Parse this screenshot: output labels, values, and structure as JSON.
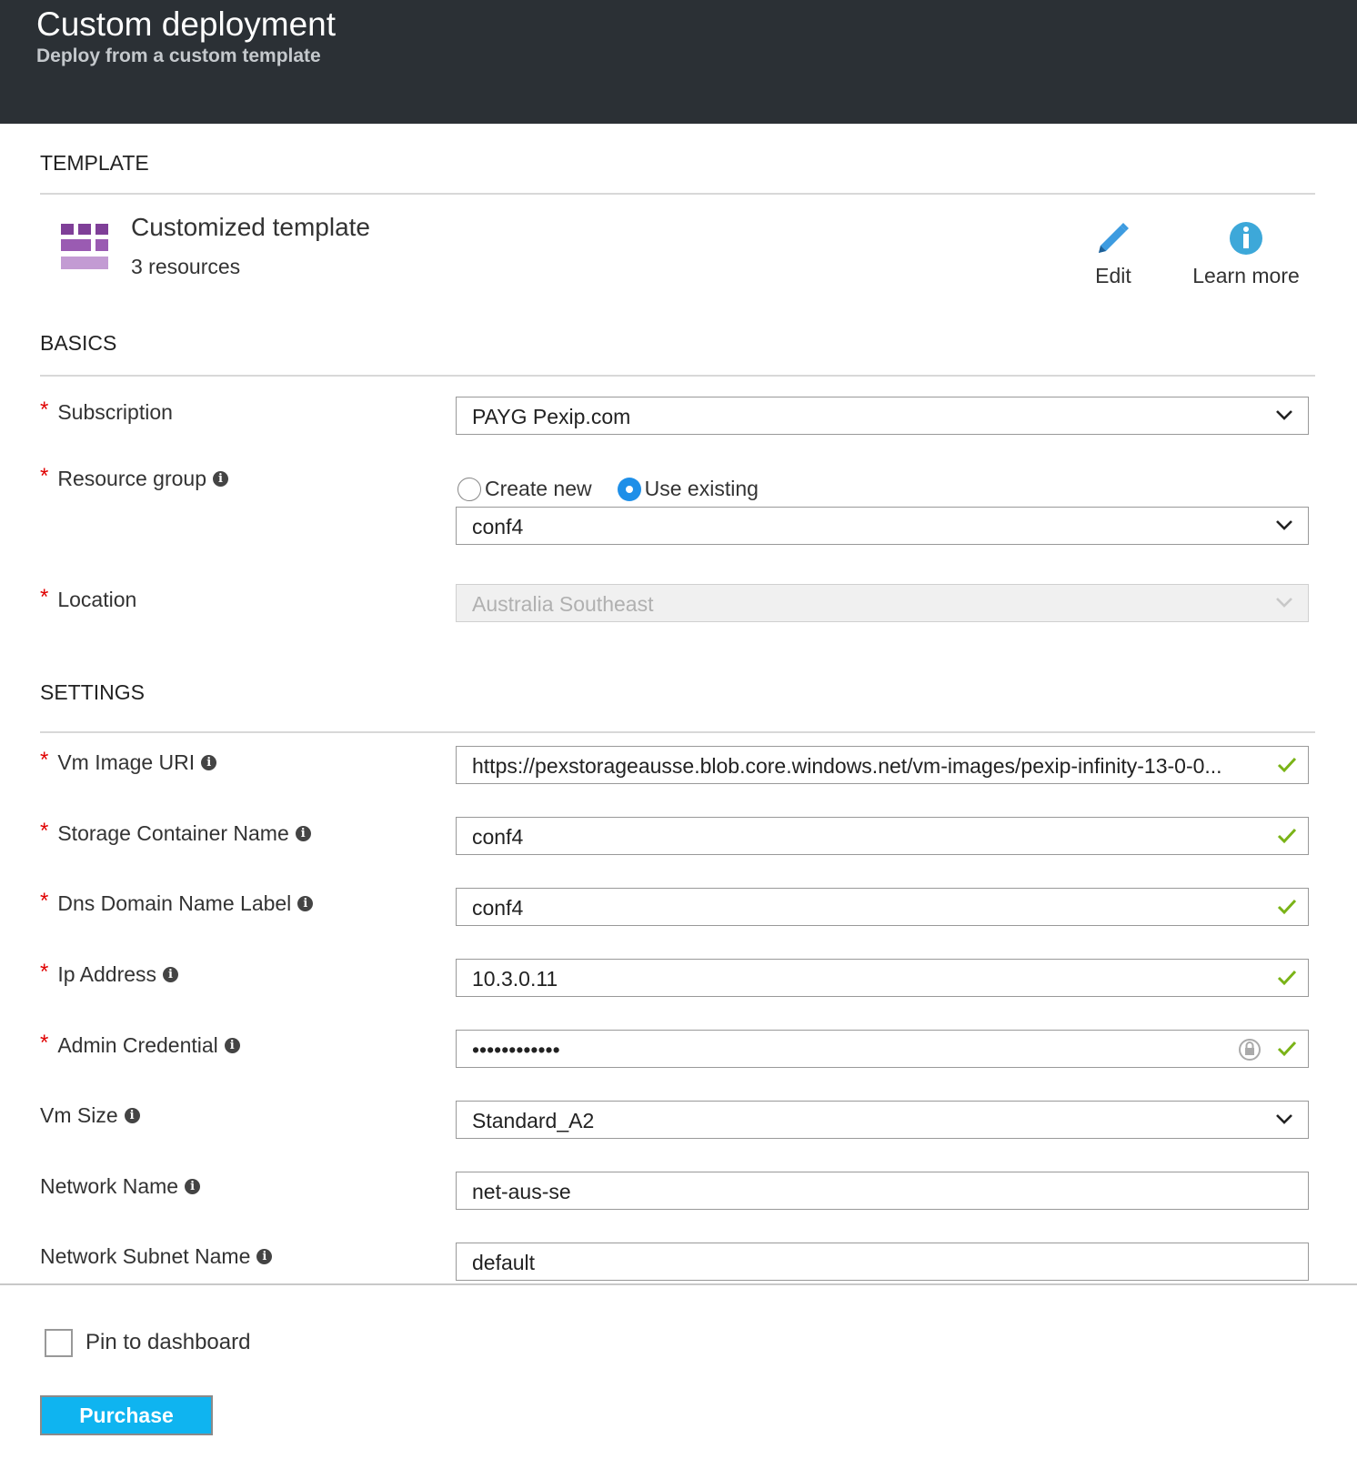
{
  "header": {
    "title": "Custom deployment",
    "subtitle": "Deploy from a custom template"
  },
  "template_section": {
    "title": "TEMPLATE",
    "name": "Customized template",
    "resources": "3 resources",
    "edit_label": "Edit",
    "learn_more_label": "Learn more",
    "icon": "template-grid-icon"
  },
  "basics": {
    "title": "BASICS",
    "subscription": {
      "label": "Subscription",
      "value": "PAYG Pexip.com"
    },
    "resource_group": {
      "label": "Resource group",
      "create_new": "Create new",
      "use_existing": "Use existing",
      "selected": "Use existing",
      "value": "conf4"
    },
    "location": {
      "label": "Location",
      "value": "Australia Southeast"
    }
  },
  "settings": {
    "title": "SETTINGS",
    "vm_image_uri": {
      "label": "Vm Image URI",
      "value": "https://pexstorageausse.blob.core.windows.net/vm-images/pexip-infinity-13-0-0..."
    },
    "storage_container": {
      "label": "Storage Container Name",
      "value": "conf4"
    },
    "dns_label": {
      "label": "Dns Domain Name Label",
      "value": "conf4"
    },
    "ip_address": {
      "label": "Ip Address",
      "value": "10.3.0.11"
    },
    "admin_credential": {
      "label": "Admin Credential",
      "value": "••••••••••••"
    },
    "vm_size": {
      "label": "Vm Size",
      "value": "Standard_A2"
    },
    "network_name": {
      "label": "Network Name",
      "value": "net-aus-se"
    },
    "subnet_name": {
      "label": "Network Subnet Name",
      "value": "default"
    }
  },
  "footer": {
    "pin_label": "Pin to dashboard",
    "purchase_label": "Purchase"
  },
  "colors": {
    "header_bg": "#2b3035",
    "accent": "#0fb4f0",
    "check": "#7ab317",
    "required": "#e00000",
    "icon_purple": "#8b4fa0"
  }
}
